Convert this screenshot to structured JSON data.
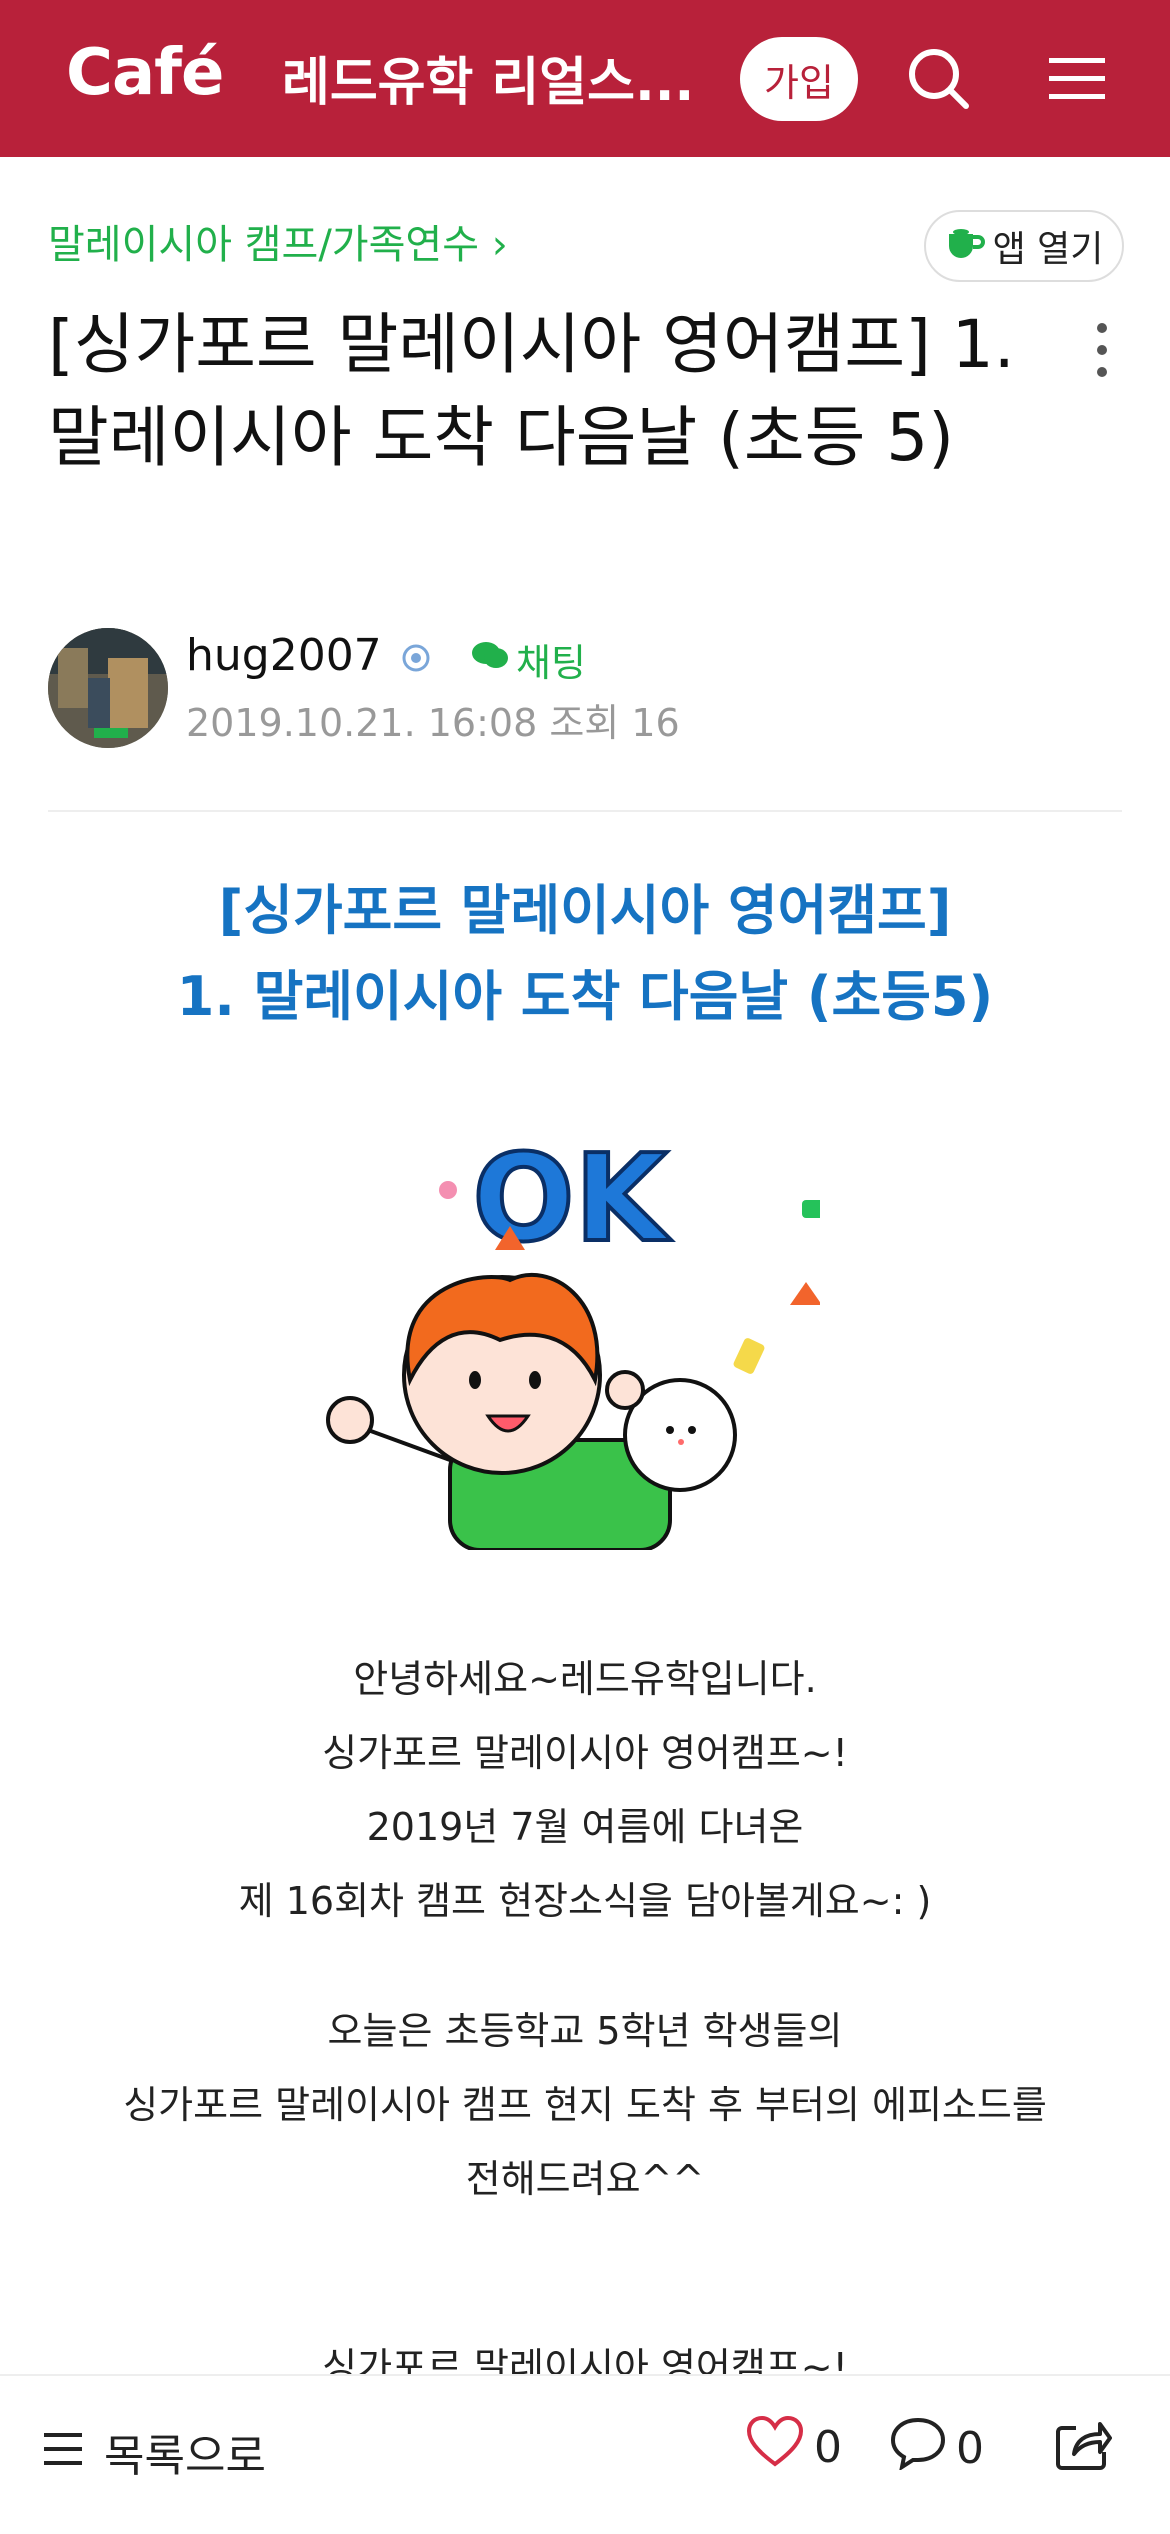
{
  "header": {
    "logo": "Café",
    "cafe_title": "레드유학 리얼스...",
    "join_label": "가입",
    "icons": [
      "search-icon",
      "menu-icon"
    ],
    "color": "#b8213a"
  },
  "post": {
    "board_link": "말레이시아 캠프/가족연수 ›",
    "app_open_label": "앱 열기",
    "title": "[싱가포르 말레이시아 영어캠프] 1. 말레이시아 도착 다음날 (초등 5)",
    "author": "hug2007",
    "chat_label": "채팅",
    "date": "2019.10.21. 16:08",
    "views": "조회 16"
  },
  "body": {
    "heading_line1": "[싱가포르 말레이시아 영어캠프]",
    "heading_line2": "1. 말레이시아 도착 다음날 (초등5)",
    "sticker_text": "OK",
    "lines": [
      "안녕하세요~레드유학입니다.",
      "싱가포르 말레이시아 영어캠프~!",
      "2019년 7월 여름에 다녀온",
      "제 16회차 캠프 현장소식을 담아볼게요~: )",
      "오늘은 초등학교 5학년 학생들의",
      "싱가포르 말레이시아 캠프  현지 도착 후 부터의 에피소드를",
      "전해드려요^^",
      "싱가포르 말레이시아 영어캠프~!"
    ]
  },
  "bottom_bar": {
    "list_label": "목록으로",
    "like_count": "0",
    "comment_count": "0"
  }
}
